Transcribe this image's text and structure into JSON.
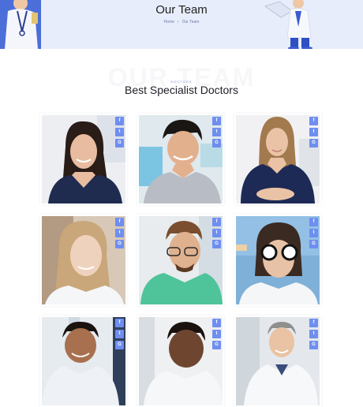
{
  "hero": {
    "title": "Our Team",
    "breadcrumb": {
      "home": "Home",
      "separator": "›",
      "current": "Our Team"
    },
    "bg_color": "#e8edfb"
  },
  "section": {
    "ghost_text": "OUR TEAM",
    "eyebrow": "DOCTORS",
    "heading": "Best Specialist Doctors"
  },
  "socials": {
    "facebook": "f",
    "twitter": "t",
    "google": "G"
  },
  "accent_color": "#6f8ef0",
  "doctors": [
    {
      "desc": "female doctor navy scrubs"
    },
    {
      "desc": "male doctor grey sweater"
    },
    {
      "desc": "female doctor navy scrubs blonde"
    },
    {
      "desc": "female doctor white coat"
    },
    {
      "desc": "male doctor green scrubs glasses"
    },
    {
      "desc": "female doctor with eye test glasses"
    },
    {
      "desc": "male doctor"
    },
    {
      "desc": "male doctor dark skin"
    },
    {
      "desc": "male doctor white coat grey hair"
    }
  ]
}
